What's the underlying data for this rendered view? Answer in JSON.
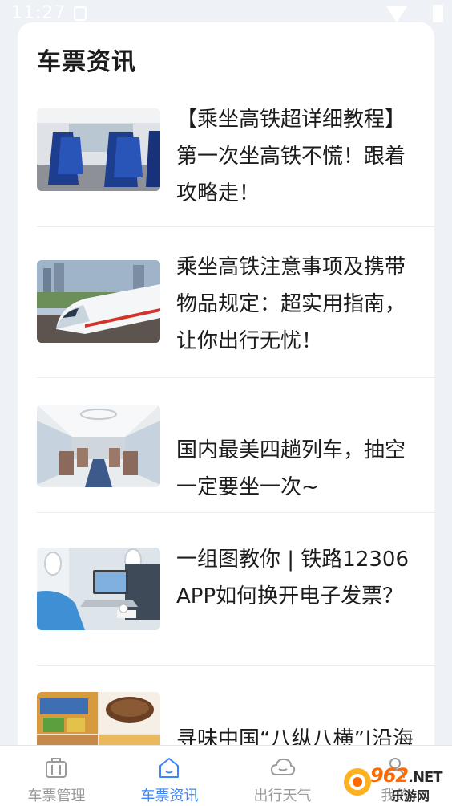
{
  "status_bar": {
    "time": "11:27"
  },
  "section": {
    "title": "车票资讯"
  },
  "news": [
    {
      "title": "【乘坐高铁超详细教程】第一次坐高铁不慌！跟着攻略走！"
    },
    {
      "title": "乘坐高铁注意事项及携带物品规定：超实用指南，让你出行无忧！"
    },
    {
      "title": "国内最美四趟列车，抽空一定要坐一次~"
    },
    {
      "title": "一组图教你 | 铁路12306 APP如何换开电子发票？"
    },
    {
      "title": "寻味中国“八纵八横”|沿海通道沿线美食"
    }
  ],
  "tabs": [
    {
      "label": "车票管理",
      "icon": "briefcase-icon",
      "active": false
    },
    {
      "label": "车票资讯",
      "icon": "home-icon",
      "active": true
    },
    {
      "label": "出行天气",
      "icon": "cloud-icon",
      "active": false
    },
    {
      "label": "我的",
      "icon": "user-icon",
      "active": false
    }
  ],
  "watermark": {
    "brand": "962",
    "domain": ".NET",
    "sub": "乐游网"
  },
  "colors": {
    "accent": "#3a86ff",
    "inactive": "#9a9a9a",
    "background": "#eef1f6"
  }
}
